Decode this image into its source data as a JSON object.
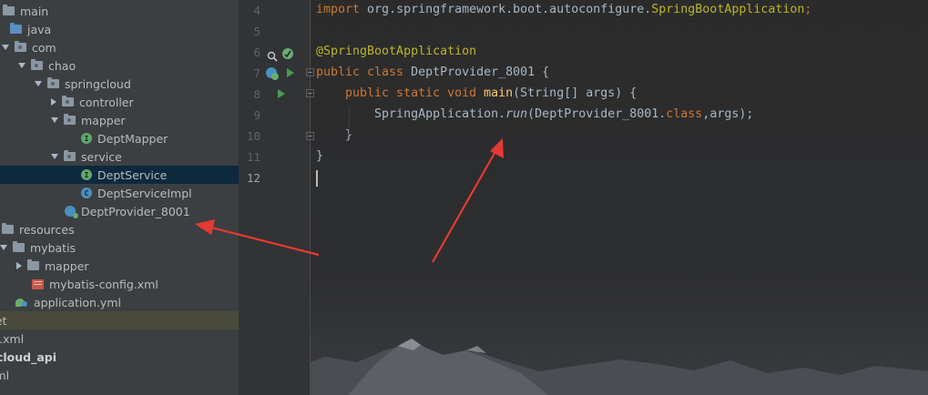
{
  "project_tree": [
    {
      "label": "main",
      "indent": -14,
      "arrow": "none",
      "icon": "folder"
    },
    {
      "label": "java",
      "indent": -6,
      "arrow": "none",
      "icon": "folder-blue"
    },
    {
      "label": "com",
      "indent": 0,
      "arrow": "down",
      "icon": "package"
    },
    {
      "label": "chao",
      "indent": 18,
      "arrow": "down",
      "icon": "package"
    },
    {
      "label": "springcloud",
      "indent": 36,
      "arrow": "down",
      "icon": "package"
    },
    {
      "label": "controller",
      "indent": 54,
      "arrow": "right",
      "icon": "package"
    },
    {
      "label": "mapper",
      "indent": 54,
      "arrow": "down",
      "icon": "package"
    },
    {
      "label": "DeptMapper",
      "indent": 72,
      "arrow": "none",
      "icon": "interface"
    },
    {
      "label": "service",
      "indent": 54,
      "arrow": "down",
      "icon": "package"
    },
    {
      "label": "DeptService",
      "indent": 72,
      "arrow": "none",
      "icon": "interface",
      "selected": true
    },
    {
      "label": "DeptServiceImpl",
      "indent": 72,
      "arrow": "none",
      "icon": "class"
    },
    {
      "label": "DeptProvider_8001",
      "indent": 54,
      "arrow": "none",
      "icon": "boot"
    },
    {
      "label": "resources",
      "indent": -14,
      "arrow": "down",
      "icon": "resources"
    },
    {
      "label": "mybatis",
      "indent": -2,
      "arrow": "down",
      "icon": "folder"
    },
    {
      "label": "mapper",
      "indent": 16,
      "arrow": "right",
      "icon": "folder"
    },
    {
      "label": "mybatis-config.xml",
      "indent": 18,
      "arrow": "none",
      "icon": "xml"
    },
    {
      "label": "application.yml",
      "indent": 0,
      "arrow": "none",
      "icon": "yml"
    },
    {
      "label": "get",
      "indent": -15,
      "arrow": "none",
      "icon": "none",
      "highlight": true
    },
    {
      "label": "m.xml",
      "indent": -15,
      "arrow": "none",
      "icon": "none"
    },
    {
      "label": "gcloud_api",
      "indent": -15,
      "arrow": "none",
      "icon": "none",
      "bold": true
    },
    {
      "label": "yml",
      "indent": -15,
      "arrow": "none",
      "icon": "none"
    }
  ],
  "editor": {
    "line_numbers": [
      "4",
      "5",
      "6",
      "7",
      "8",
      "9",
      "10",
      "11",
      "12"
    ],
    "current_line": "12",
    "lines": [
      [
        {
          "t": "import ",
          "c": "kw"
        },
        {
          "t": "org.springframework.boot.autoconfigure.",
          "c": ""
        },
        {
          "t": "SpringBootApplication",
          "c": "ann"
        },
        {
          "t": ";",
          "c": "kw"
        }
      ],
      [],
      [
        {
          "t": "@SpringBootApplication",
          "c": "ann"
        }
      ],
      [
        {
          "t": "public class ",
          "c": "kw"
        },
        {
          "t": "DeptProvider_8001 {",
          "c": ""
        }
      ],
      [
        {
          "t": "    public static void ",
          "c": "kw"
        },
        {
          "t": "main",
          "c": "fn"
        },
        {
          "t": "(String[] args) {",
          "c": ""
        }
      ],
      [
        {
          "t": "        SpringApplication.",
          "c": ""
        },
        {
          "t": "run",
          "c": "it"
        },
        {
          "t": "(DeptProvider_8001.",
          "c": ""
        },
        {
          "t": "class",
          "c": "kw"
        },
        {
          "t": ",args);",
          "c": ""
        }
      ],
      [
        {
          "t": "    }",
          "c": ""
        }
      ],
      [
        {
          "t": "}",
          "c": ""
        }
      ],
      []
    ]
  },
  "colors": {
    "arrow_annotation": "#e53935",
    "selected_row": "#0d293e"
  }
}
